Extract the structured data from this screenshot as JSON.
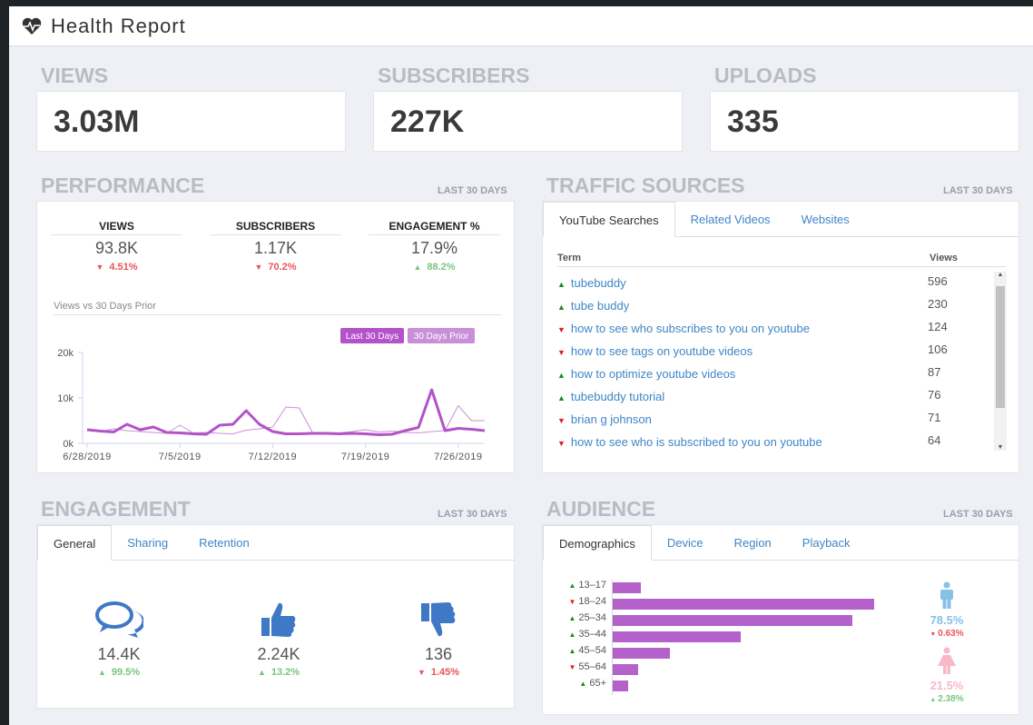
{
  "header": {
    "title": "Health Report",
    "icon": "heartbeat-icon"
  },
  "kpis": [
    {
      "label": "VIEWS",
      "value": "3.03M"
    },
    {
      "label": "SUBSCRIBERS",
      "value": "227K"
    },
    {
      "label": "UPLOADS",
      "value": "335"
    }
  ],
  "performance": {
    "title": "PERFORMANCE",
    "period": "LAST 30 DAYS",
    "stats": [
      {
        "label": "VIEWS",
        "value": "93.8K",
        "change": "4.51%",
        "dir": "down"
      },
      {
        "label": "SUBSCRIBERS",
        "value": "1.17K",
        "change": "70.2%",
        "dir": "down"
      },
      {
        "label": "ENGAGEMENT %",
        "value": "17.9%",
        "change": "88.2%",
        "dir": "up"
      }
    ],
    "chart_title": "Views vs 30 Days Prior"
  },
  "chart_data": {
    "type": "line",
    "title": "Views vs 30 Days Prior",
    "x": [
      "6/28/2019",
      "6/29/2019",
      "6/30/2019",
      "7/1/2019",
      "7/2/2019",
      "7/3/2019",
      "7/4/2019",
      "7/5/2019",
      "7/6/2019",
      "7/7/2019",
      "7/8/2019",
      "7/9/2019",
      "7/10/2019",
      "7/11/2019",
      "7/12/2019",
      "7/13/2019",
      "7/14/2019",
      "7/15/2019",
      "7/16/2019",
      "7/17/2019",
      "7/18/2019",
      "7/19/2019",
      "7/20/2019",
      "7/21/2019",
      "7/22/2019",
      "7/23/2019",
      "7/24/2019",
      "7/25/2019",
      "7/26/2019",
      "7/27/2019",
      "7/28/2019"
    ],
    "xticks": [
      "6/28/2019",
      "7/5/2019",
      "7/12/2019",
      "7/19/2019",
      "7/26/2019"
    ],
    "yticks": [
      "0k",
      "10k",
      "20k"
    ],
    "ylim": [
      0,
      20000
    ],
    "legend": "top-right",
    "series": [
      {
        "name": "Last 30 Days",
        "color": "#b352c9",
        "values": [
          3000,
          2700,
          2500,
          4200,
          3000,
          3600,
          2400,
          2300,
          2100,
          2000,
          4000,
          4200,
          7200,
          4200,
          2600,
          2100,
          2100,
          2200,
          2200,
          2100,
          2200,
          2100,
          1900,
          2000,
          2800,
          3500,
          11800,
          2800,
          3300,
          3100,
          2800
        ]
      },
      {
        "name": "30 Days Prior",
        "color": "#c98fd8",
        "values": [
          3000,
          2600,
          3200,
          2800,
          2600,
          2400,
          2200,
          4000,
          2300,
          2400,
          2200,
          2100,
          2900,
          3200,
          3600,
          8000,
          7800,
          2400,
          2400,
          2300,
          2600,
          3000,
          2500,
          2700,
          2400,
          2300,
          2600,
          2800,
          8300,
          5000,
          5000
        ]
      }
    ]
  },
  "traffic": {
    "title": "TRAFFIC SOURCES",
    "period": "LAST 30 DAYS",
    "tabs": [
      "YouTube Searches",
      "Related Videos",
      "Websites"
    ],
    "col_term": "Term",
    "col_views": "Views",
    "rows": [
      {
        "term": "tubebuddy",
        "views": "596",
        "dir": "up"
      },
      {
        "term": "tube buddy",
        "views": "230",
        "dir": "up"
      },
      {
        "term": "how to see who subscribes to you on youtube",
        "views": "124",
        "dir": "down"
      },
      {
        "term": "how to see tags on youtube videos",
        "views": "106",
        "dir": "down"
      },
      {
        "term": "how to optimize youtube videos",
        "views": "87",
        "dir": "up"
      },
      {
        "term": "tubebuddy tutorial",
        "views": "76",
        "dir": "up"
      },
      {
        "term": "brian g johnson",
        "views": "71",
        "dir": "down"
      },
      {
        "term": "how to see who is subscribed to you on youtube",
        "views": "64",
        "dir": "down"
      }
    ]
  },
  "engagement": {
    "title": "ENGAGEMENT",
    "period": "LAST 30 DAYS",
    "tabs": [
      "General",
      "Sharing",
      "Retention"
    ],
    "items": [
      {
        "icon": "comments-icon",
        "value": "14.4K",
        "change": "99.5%",
        "dir": "up"
      },
      {
        "icon": "thumbs-up-icon",
        "value": "2.24K",
        "change": "13.2%",
        "dir": "up"
      },
      {
        "icon": "thumbs-down-icon",
        "value": "136",
        "change": "1.45%",
        "dir": "down"
      }
    ]
  },
  "audience": {
    "title": "AUDIENCE",
    "period": "LAST 30 DAYS",
    "tabs": [
      "Demographics",
      "Device",
      "Region",
      "Playback"
    ],
    "ages": [
      {
        "label": "13–17",
        "dir": "up",
        "value": 3.4
      },
      {
        "label": "18–24",
        "dir": "down",
        "value": 31.5
      },
      {
        "label": "25–34",
        "dir": "up",
        "value": 28.9
      },
      {
        "label": "35–44",
        "dir": "up",
        "value": 15.4
      },
      {
        "label": "45–54",
        "dir": "up",
        "value": 6.9
      },
      {
        "label": "55–64",
        "dir": "down",
        "value": 3.1
      },
      {
        "label": "65+",
        "dir": "up",
        "value": 1.9
      }
    ],
    "male": {
      "value": "78.5%",
      "change": "0.63%",
      "dir": "down",
      "color": "#86c1e6"
    },
    "female": {
      "value": "21.5%",
      "change": "2.38%",
      "dir": "up",
      "color": "#f9b8c7"
    }
  }
}
